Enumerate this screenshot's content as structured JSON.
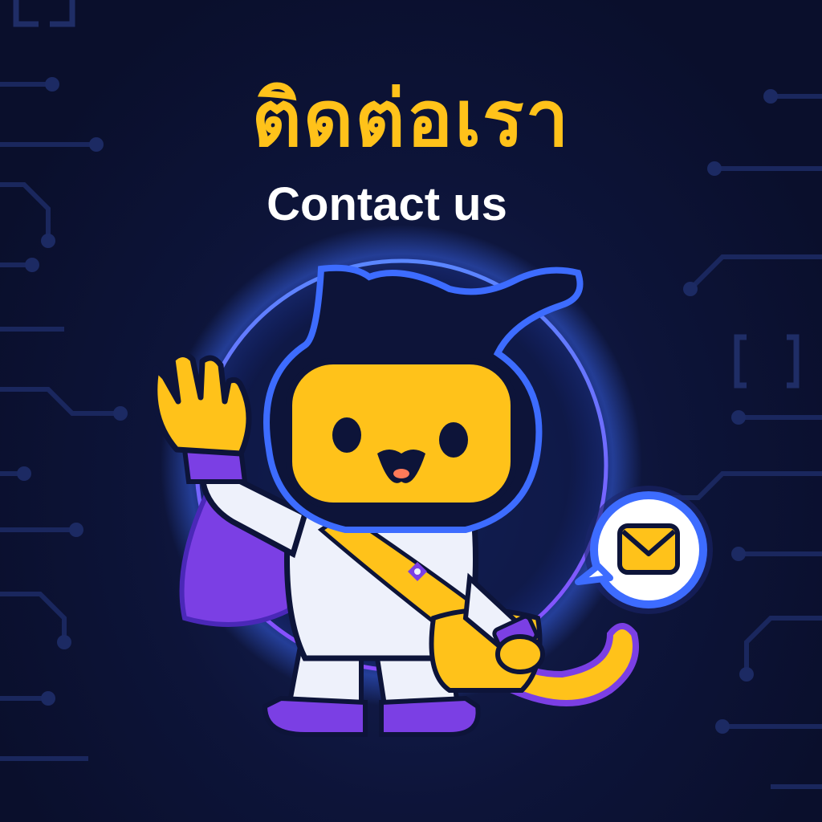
{
  "heading": {
    "thai": "ติดต่อเรา",
    "english": "Contact us"
  },
  "illustration": {
    "subject": "mascot-cat-astronaut",
    "icons": [
      "waving-hand-icon",
      "mail-icon",
      "speech-bubble-icon"
    ]
  },
  "colors": {
    "background": "#0a0f2c",
    "accent_yellow": "#ffc21a",
    "accent_purple": "#7b3fe4",
    "glow_blue": "#3d6cff",
    "text_white": "#ffffff"
  }
}
